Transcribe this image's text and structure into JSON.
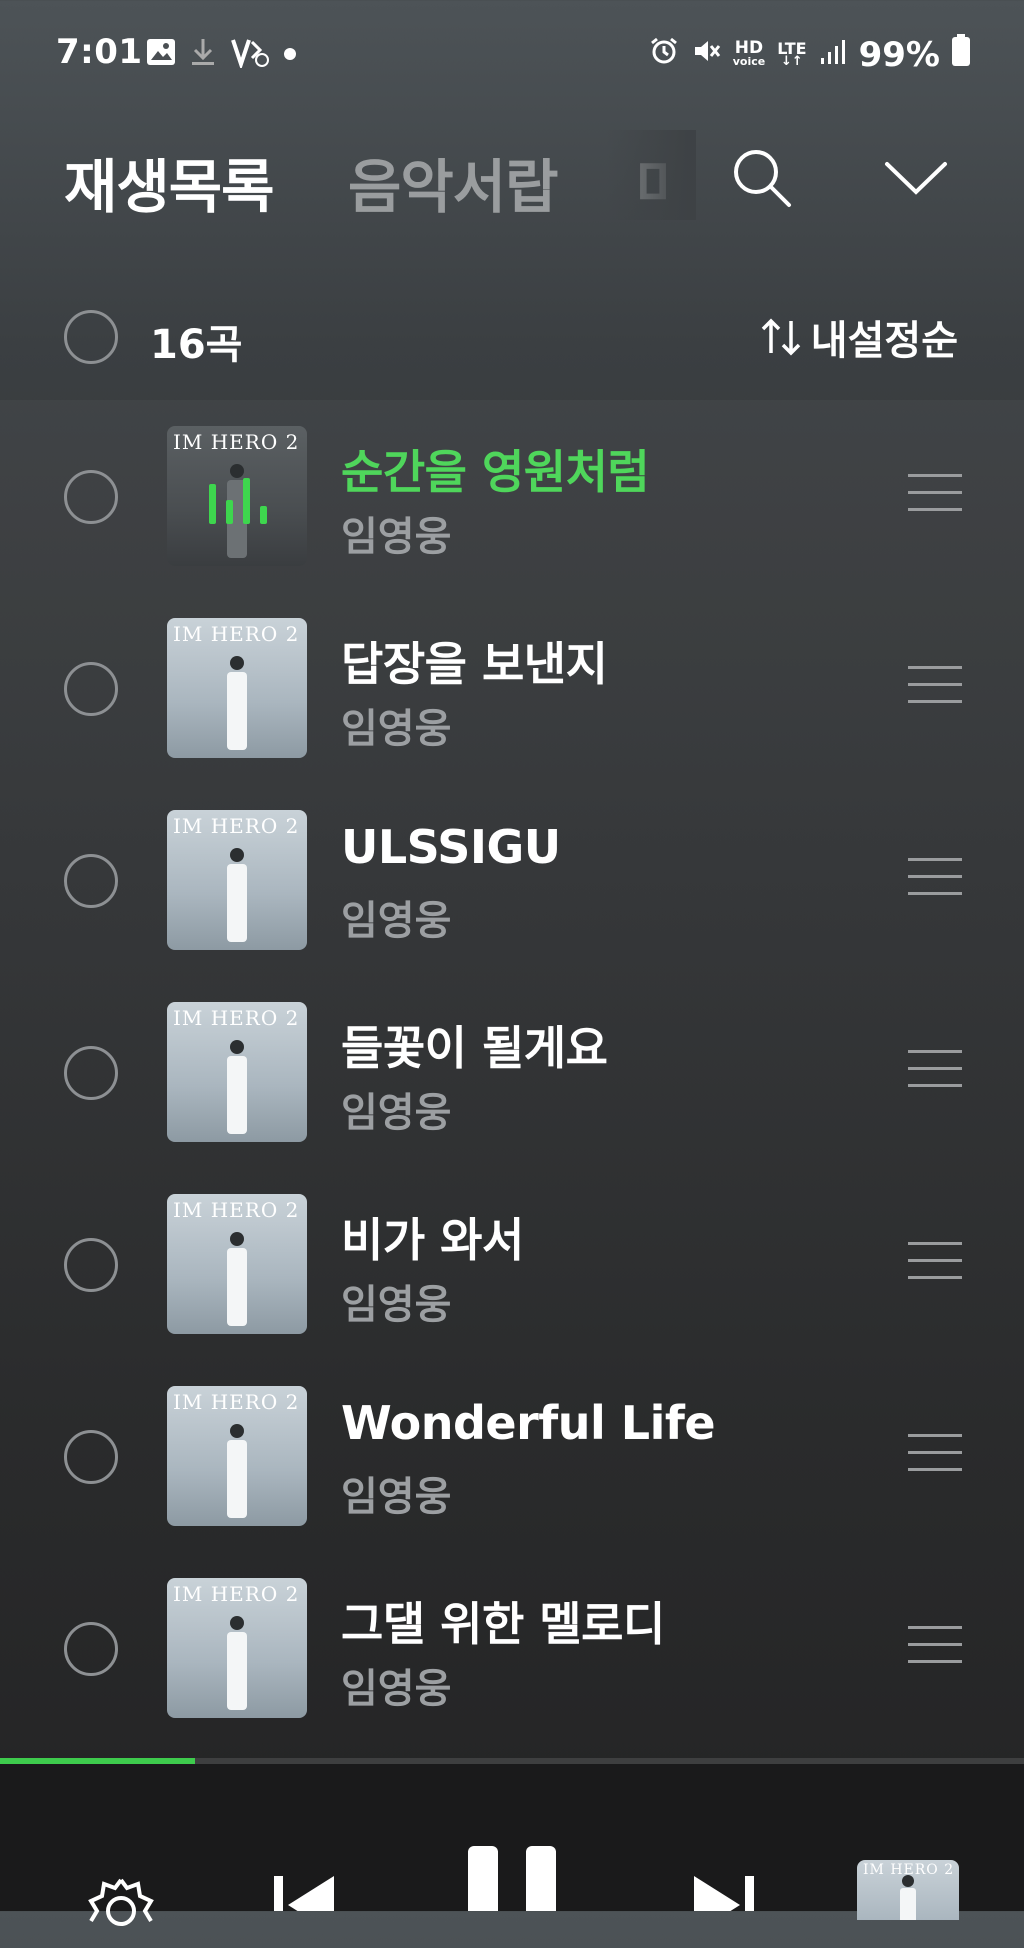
{
  "status": {
    "time": "7:01",
    "battery": "99%",
    "hd_label": "HD",
    "voice_label": "voice",
    "lte_label": "LTE"
  },
  "header": {
    "tabs": [
      {
        "label": "재생목록"
      },
      {
        "label": "음악서랍"
      },
      {
        "label": "마"
      }
    ]
  },
  "toolbar": {
    "count": "16곡",
    "sort_label": "내설정순"
  },
  "album": {
    "title_text": "IM HERO 2"
  },
  "songs": [
    {
      "title": "순간을 영원처럼",
      "artist": "임영웅",
      "playing": true
    },
    {
      "title": "답장을 보낸지",
      "artist": "임영웅"
    },
    {
      "title": "ULSSIGU",
      "artist": "임영웅"
    },
    {
      "title": "들꽃이 될게요",
      "artist": "임영웅"
    },
    {
      "title": "비가 와서",
      "artist": "임영웅"
    },
    {
      "title": "Wonderful Life",
      "artist": "임영웅"
    },
    {
      "title": "그댈 위한 멜로디",
      "artist": "임영웅"
    }
  ],
  "player": {
    "progress": 0.19
  },
  "colors": {
    "accent": "#3ed64e",
    "playing_title": "#4fd65b"
  }
}
